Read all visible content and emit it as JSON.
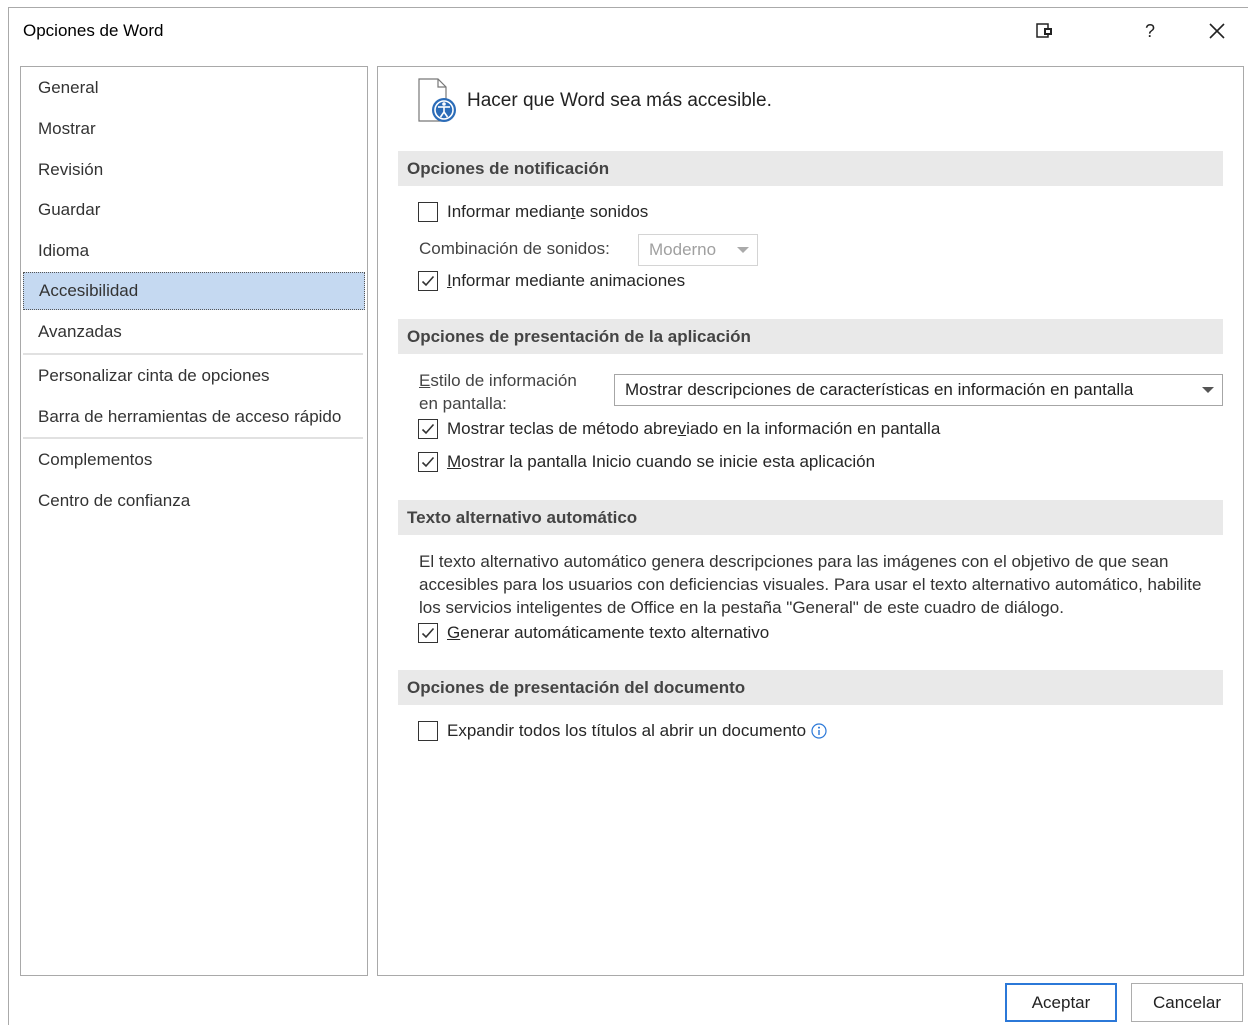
{
  "window": {
    "title": "Opciones de Word",
    "help_label": "?",
    "close_label": "✕"
  },
  "nav": {
    "items": [
      {
        "label": "General"
      },
      {
        "label": "Mostrar"
      },
      {
        "label": "Revisión"
      },
      {
        "label": "Guardar"
      },
      {
        "label": "Idioma"
      },
      {
        "label": "Accesibilidad",
        "selected": true
      },
      {
        "label": "Avanzadas"
      },
      {
        "label": "Personalizar cinta de opciones"
      },
      {
        "label": "Barra de herramientas de acceso rápido"
      },
      {
        "label": "Complementos"
      },
      {
        "label": "Centro de confianza"
      }
    ]
  },
  "main": {
    "header": "Hacer que Word sea más accesible.",
    "sections": {
      "notification": {
        "title": "Opciones de notificación",
        "sounds_label_pre": "Informar median",
        "sounds_label_u": "t",
        "sounds_label_post": "e sonidos",
        "sounds_checked": false,
        "sound_scheme_label": "Combinación de sonidos:",
        "sound_scheme_value": "Moderno",
        "animations_label_u": "I",
        "animations_label_post": "nformar mediante animaciones",
        "animations_checked": true
      },
      "app_display": {
        "title": "Opciones de presentación de la aplicación",
        "tooltip_style_label_u": "E",
        "tooltip_style_label_line1_post": "stilo de información",
        "tooltip_style_label_line2": "en pantalla:",
        "tooltip_style_value": "Mostrar descripciones de características en información en pantalla",
        "shortcut_keys_pre": "Mostrar teclas de método abre",
        "shortcut_keys_u": "v",
        "shortcut_keys_post": "iado en la información en pantalla",
        "shortcut_keys_checked": true,
        "start_screen_u": "M",
        "start_screen_post": "ostrar la pantalla Inicio cuando se inicie esta aplicación",
        "start_screen_checked": true
      },
      "alt_text": {
        "title": "Texto alternativo automático",
        "description": "El texto alternativo automático genera descripciones para las imágenes con el objetivo de que sean accesibles para los usuarios con deficiencias visuales. Para usar el texto alternativo automático, habilite los servicios inteligentes de Office en la pestaña \"General\" de este cuadro de diálogo.",
        "generate_u": "G",
        "generate_post": "enerar automáticamente texto alternativo",
        "generate_checked": true
      },
      "doc_display": {
        "title": "Opciones de presentación del documento",
        "expand_label": "Expandir todos los títulos al abrir un documento",
        "expand_checked": false
      }
    }
  },
  "footer": {
    "ok_label": "Aceptar",
    "cancel_label": "Cancelar"
  },
  "colors": {
    "selected_nav_bg": "#c5d9f1",
    "section_bg": "#e9e9e9",
    "accent": "#2b78d8"
  },
  "icons": {
    "restore": "restore-window-icon",
    "help": "help-icon",
    "close": "close-icon",
    "header": "accessibility-document-icon",
    "info": "info-icon"
  }
}
